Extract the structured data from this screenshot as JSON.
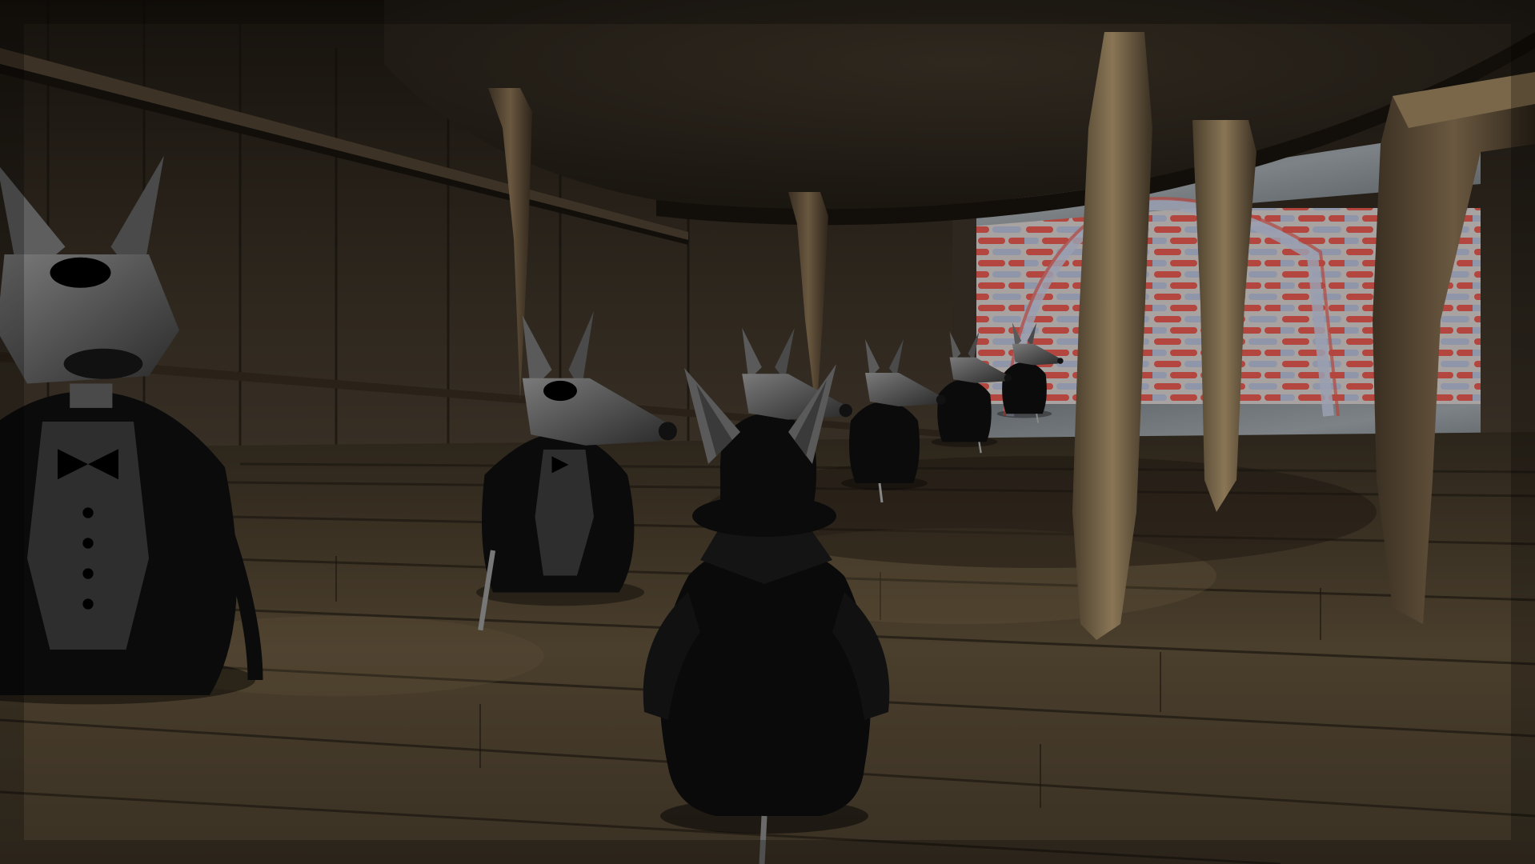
{
  "scene": {
    "type": "3d-game-view",
    "hud_text": [],
    "palette": {
      "wall": "#2e271e",
      "wall_dark": "#15110c",
      "floor": "#3e3426",
      "floor_light": "#5e5038",
      "table_underside": "#2a241c",
      "table_leg": "#5c4c36",
      "brick_red": "#b0463e",
      "brick_gray": "#8f96a8",
      "stone": "#6a7076",
      "rat_fur": "#3a3a3a",
      "rat_fur_light": "#6e6e6e",
      "tux": "#0b0b0b",
      "shirt": "#2e2e2e"
    },
    "characters": [
      {
        "name": "rat-waiter-near-left",
        "kind": "rat in tuxedo"
      },
      {
        "name": "rat-waiter-2",
        "kind": "rat in tuxedo with cane"
      },
      {
        "name": "rat-waiter-3",
        "kind": "rat in tuxedo"
      },
      {
        "name": "rat-waiter-4",
        "kind": "rat in tuxedo"
      },
      {
        "name": "rat-waiter-5",
        "kind": "rat in tuxedo"
      },
      {
        "name": "rat-waiter-6",
        "kind": "rat in tuxedo"
      },
      {
        "name": "player-rat",
        "kind": "rat in top hat and coat, seen from behind"
      }
    ]
  }
}
